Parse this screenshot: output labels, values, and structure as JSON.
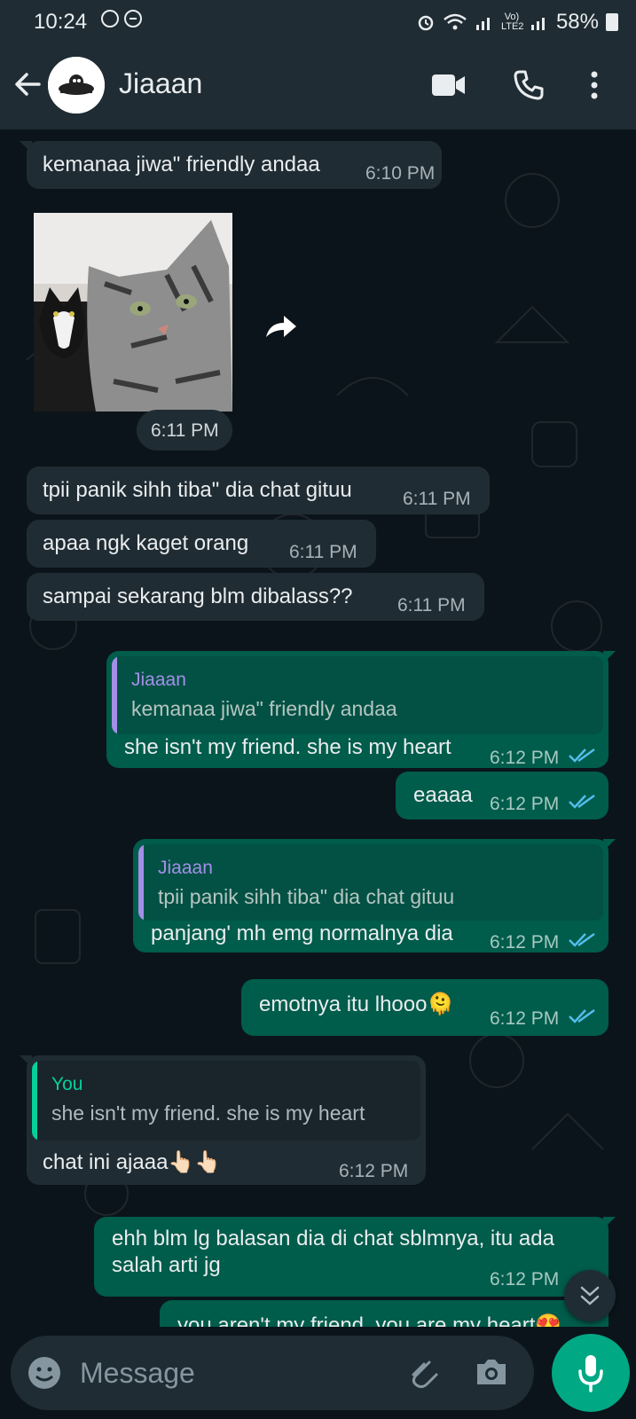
{
  "status_bar": {
    "time": "10:24",
    "network_label": "Vo) LTE2",
    "battery": "58%"
  },
  "header": {
    "contact_name": "Jiaaan"
  },
  "messages": [
    {
      "dir": "in",
      "text": "kemanaa jiwa\" friendly andaa",
      "time": "6:10 PM"
    },
    {
      "dir": "in",
      "type": "image",
      "time": "6:11 PM"
    },
    {
      "dir": "in",
      "text": "tpii panik sihh tiba\" dia chat gituu",
      "time": "6:11 PM"
    },
    {
      "dir": "in",
      "text": "apaa ngk kaget orang",
      "time": "6:11 PM"
    },
    {
      "dir": "in",
      "text": "sampai sekarang blm dibalass??",
      "time": "6:11 PM"
    },
    {
      "dir": "out",
      "quote_name": "Jiaaan",
      "quote_text": "kemanaa jiwa\" friendly andaa",
      "text": "she isn't my friend. she is my heart",
      "time": "6:12 PM"
    },
    {
      "dir": "out",
      "text": "eaaaa",
      "time": "6:12 PM"
    },
    {
      "dir": "out",
      "quote_name": "Jiaaan",
      "quote_text": "tpii panik sihh tiba\" dia chat gituu",
      "text": "panjang' mh emg normalnya dia",
      "time": "6:12 PM"
    },
    {
      "dir": "out",
      "text": "emotnya itu lhooo🫠",
      "time": "6:12 PM"
    },
    {
      "dir": "in",
      "quote_name": "You",
      "quote_text": "she isn't my friend. she is my heart",
      "text": "chat ini ajaaa👆🏻👆🏻",
      "time": "6:12 PM"
    },
    {
      "dir": "out",
      "text": "ehh blm lg balasan dia di chat sblmnya, itu ada salah arti jg",
      "time": "6:12 PM"
    },
    {
      "dir": "out",
      "text": "you aren't my friend. you are my heart😍"
    }
  ],
  "composer": {
    "placeholder": "Message"
  },
  "colors": {
    "background": "#0b141a",
    "header": "#1f2c33",
    "incoming": "#202c33",
    "outgoing": "#005c4b",
    "read_ticks": "#53bdeb",
    "quote_jiaaan": "#a48fe8",
    "quote_you": "#06cf9c",
    "accent": "#00a884"
  },
  "icons": {
    "back": "arrow-left-icon",
    "video": "video-call-icon",
    "call": "phone-icon",
    "menu": "more-vertical-icon",
    "forward": "forward-icon",
    "emoji": "emoji-icon",
    "attach": "paperclip-icon",
    "camera": "camera-icon",
    "mic": "microphone-icon",
    "scroll": "double-chevron-down-icon"
  }
}
